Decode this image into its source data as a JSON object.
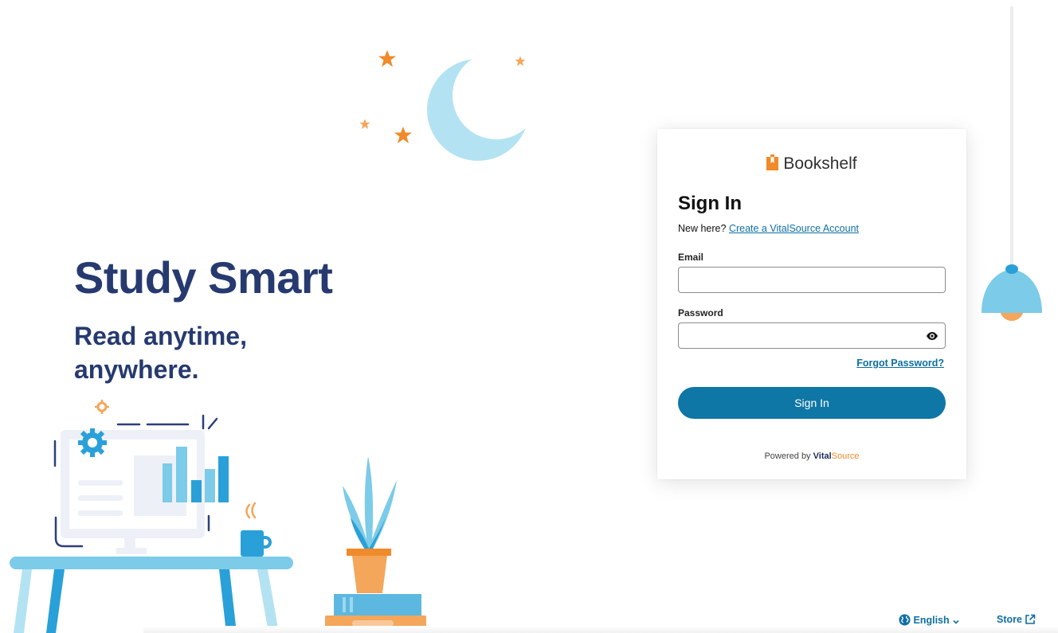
{
  "hero": {
    "title": "Study Smart",
    "subtitle": "Read anytime, anywhere."
  },
  "card": {
    "brand_name": "Bookshelf",
    "brand_icon": "bookshelf-logo-icon",
    "title": "Sign In",
    "new_here_text": "New here?",
    "create_account_link": "Create a VitalSource Account",
    "email_label": "Email",
    "email_value": "",
    "password_label": "Password",
    "password_value": "",
    "password_toggle_icon": "eye-icon",
    "forgot_password_link": "Forgot Password?",
    "signin_button": "Sign In",
    "powered_by": "Powered by",
    "powered_brand_vital": "Vital",
    "powered_brand_source": "Source"
  },
  "footer": {
    "language": "English",
    "language_icon": "globe-icon",
    "store": "Store",
    "store_icon": "external-link-icon"
  },
  "colors": {
    "brand_navy": "#263a70",
    "accent_blue": "#0f77a6",
    "illustration_blue": "#7ccbe8",
    "illustration_orange": "#f08a2a"
  }
}
